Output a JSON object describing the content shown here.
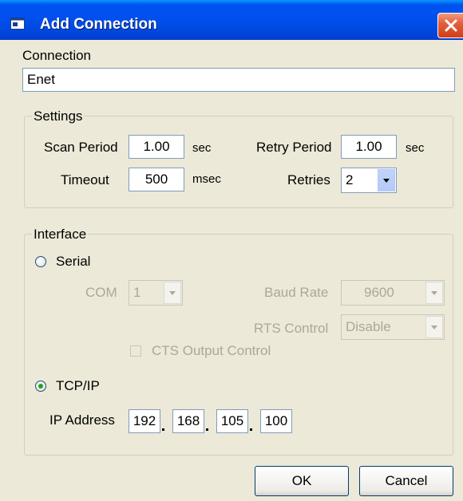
{
  "window": {
    "title": "Add Connection",
    "title_icon": "window-app-icon",
    "close_icon": "close-icon"
  },
  "connection": {
    "label": "Connection",
    "value": "Enet"
  },
  "settings": {
    "legend": "Settings",
    "scan_period_label": "Scan Period",
    "scan_period_value": "1.00",
    "scan_period_unit": "sec",
    "retry_period_label": "Retry Period",
    "retry_period_value": "1.00",
    "retry_period_unit": "sec",
    "timeout_label": "Timeout",
    "timeout_value": "500",
    "timeout_unit": "msec",
    "retries_label": "Retries",
    "retries_value": "2"
  },
  "interface": {
    "legend": "Interface",
    "serial_label": "Serial",
    "serial_selected": false,
    "com_label": "COM",
    "com_value": "1",
    "baud_rate_label": "Baud Rate",
    "baud_rate_value": "9600",
    "rts_control_label": "RTS Control",
    "rts_control_value": "Disable",
    "cts_label": "CTS Output Control",
    "cts_checked": false,
    "tcpip_label": "TCP/IP",
    "tcpip_selected": true,
    "ip_label": "IP Address",
    "ip_octets": [
      "192",
      "168",
      "105",
      "100"
    ]
  },
  "buttons": {
    "ok": "OK",
    "cancel": "Cancel"
  },
  "colors": {
    "titlebar": "#0054e3",
    "dialog_bg": "#ece9d8",
    "close": "#e2603c",
    "radio_dot": "#21a121"
  }
}
